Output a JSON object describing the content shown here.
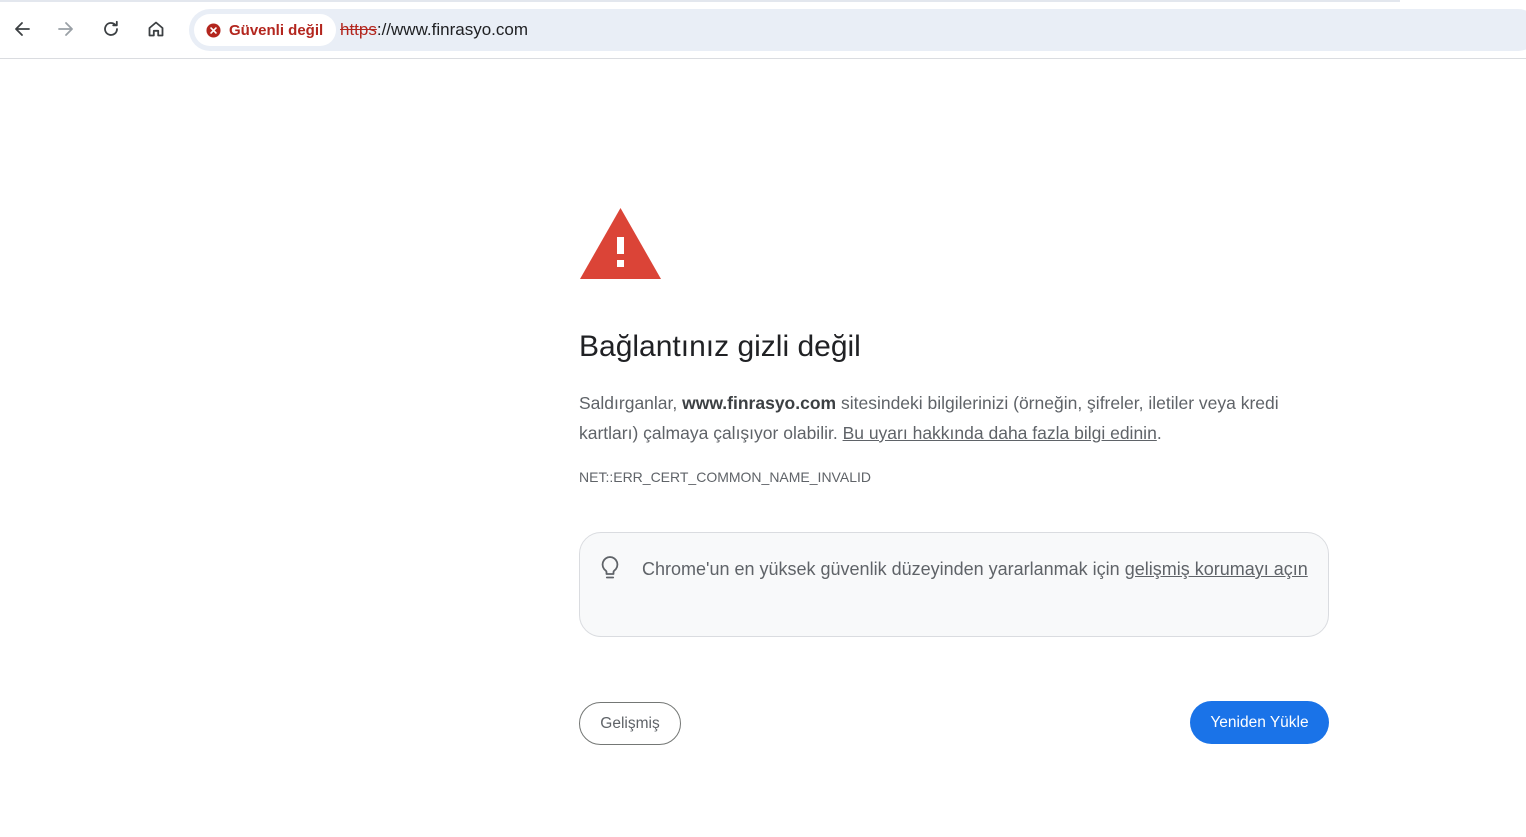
{
  "toolbar": {
    "security_chip_label": "Güvenli değil",
    "url_scheme": "https",
    "url_rest": "://www.finrasyo.com"
  },
  "icons": {
    "back": "back-arrow-icon",
    "forward": "forward-arrow-icon",
    "reload": "reload-icon",
    "home": "home-icon",
    "not_secure": "not-secure-x-icon",
    "warning": "warning-triangle-icon",
    "tip": "lightbulb-icon"
  },
  "interstitial": {
    "heading": "Bağlantınız gizli değil",
    "msg_prefix": "Saldırganlar, ",
    "msg_domain": "www.finrasyo.com",
    "msg_middle": " sitesindeki bilgilerinizi (örneğin, şifreler, iletiler veya kredi kartları) çalmaya çalışıyor olabilir. ",
    "msg_link": "Bu uyarı hakkında daha fazla bilgi edinin",
    "msg_suffix": ".",
    "error_code": "NET::ERR_CERT_COMMON_NAME_INVALID",
    "tip_prefix": "Chrome'un en yüksek güvenlik düzeyinden yararlanmak için ",
    "tip_link": "gelişmiş korumayı açın",
    "advanced_button": "Gelişmiş",
    "reload_button": "Yeniden Yükle"
  },
  "colors": {
    "danger": "#b3261e",
    "warning_triangle": "#db4437",
    "primary_button": "#1a73e8",
    "omnibox_bg": "#e9eef6"
  }
}
